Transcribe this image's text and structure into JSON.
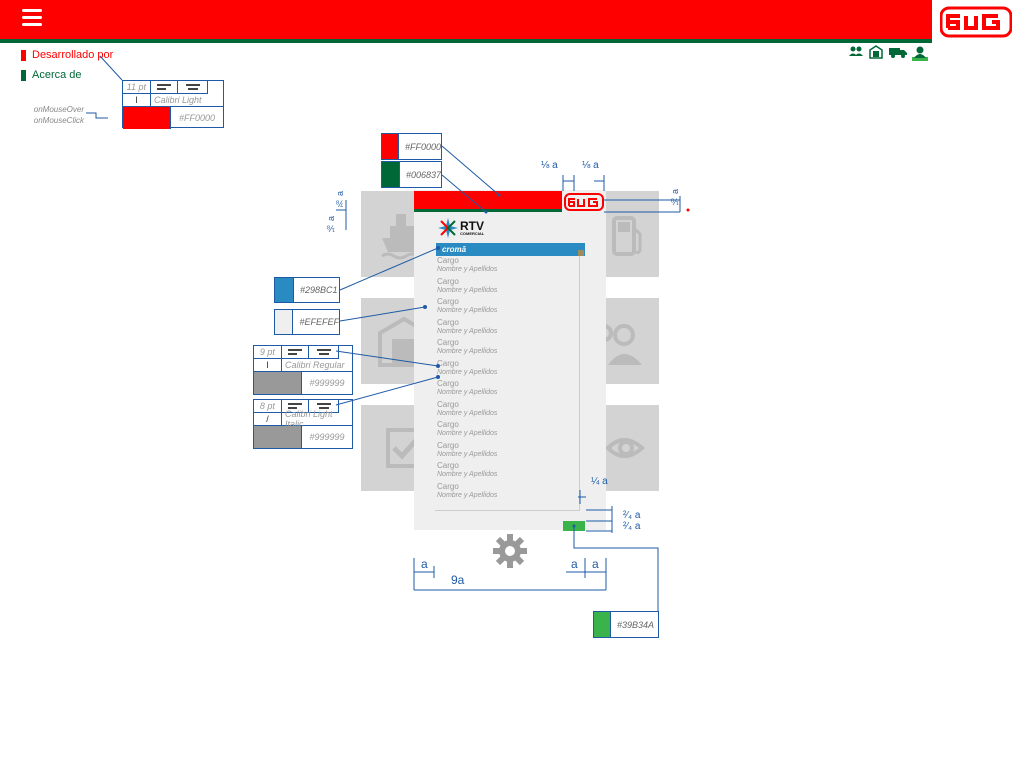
{
  "menu": {
    "developed_by": "Desarrollado por",
    "about": "Acerca de"
  },
  "header_icons": [
    "group-icon",
    "building-icon",
    "truck-icon",
    "person-icon"
  ],
  "spec_menu": {
    "size": "11 pt",
    "font": "Calibri Light",
    "color": "#FF0000",
    "hover": "onMouseOver",
    "click": "onMouseClick"
  },
  "colors": {
    "red": "#FF0000",
    "green": "#006837",
    "blue": "#298BC1",
    "bg": "#EFEFEF",
    "text": "#999999",
    "button": "#39B34A"
  },
  "spec_cargo": {
    "size": "9 pt",
    "font": "Calibri Regular",
    "color": "#999999"
  },
  "spec_nombre": {
    "size": "8 pt",
    "font": "Calibri Light Italic",
    "color": "#999999"
  },
  "phone": {
    "brand": "RTV",
    "brand_sub": "COMERCIAL",
    "bar_label": "cromā",
    "items": [
      {
        "role": "Cargo",
        "name": "Nombre y Apellidos"
      },
      {
        "role": "Cargo",
        "name": "Nombre y Apellidos"
      },
      {
        "role": "Cargo",
        "name": "Nombre y Apellidos"
      },
      {
        "role": "Cargo",
        "name": "Nombre y Apellidos"
      },
      {
        "role": "Cargo",
        "name": "Nombre y Apellidos"
      },
      {
        "role": "Cargo",
        "name": "Nombre y Apellidos"
      },
      {
        "role": "Cargo",
        "name": "Nombre y Apellidos"
      },
      {
        "role": "Cargo",
        "name": "Nombre y Apellidos"
      },
      {
        "role": "Cargo",
        "name": "Nombre y Apellidos"
      },
      {
        "role": "Cargo",
        "name": "Nombre y Apellidos"
      },
      {
        "role": "Cargo",
        "name": "Nombre y Apellidos"
      },
      {
        "role": "Cargo",
        "name": "Nombre y Apellidos"
      }
    ]
  },
  "dims": {
    "eighth_a": "⅛ a",
    "seven_eighths_a": "⅞ a",
    "quarter_a": "¼ a",
    "two_quarters_a": "²⁄₄ a",
    "a": "a",
    "nine_a": "9a"
  }
}
